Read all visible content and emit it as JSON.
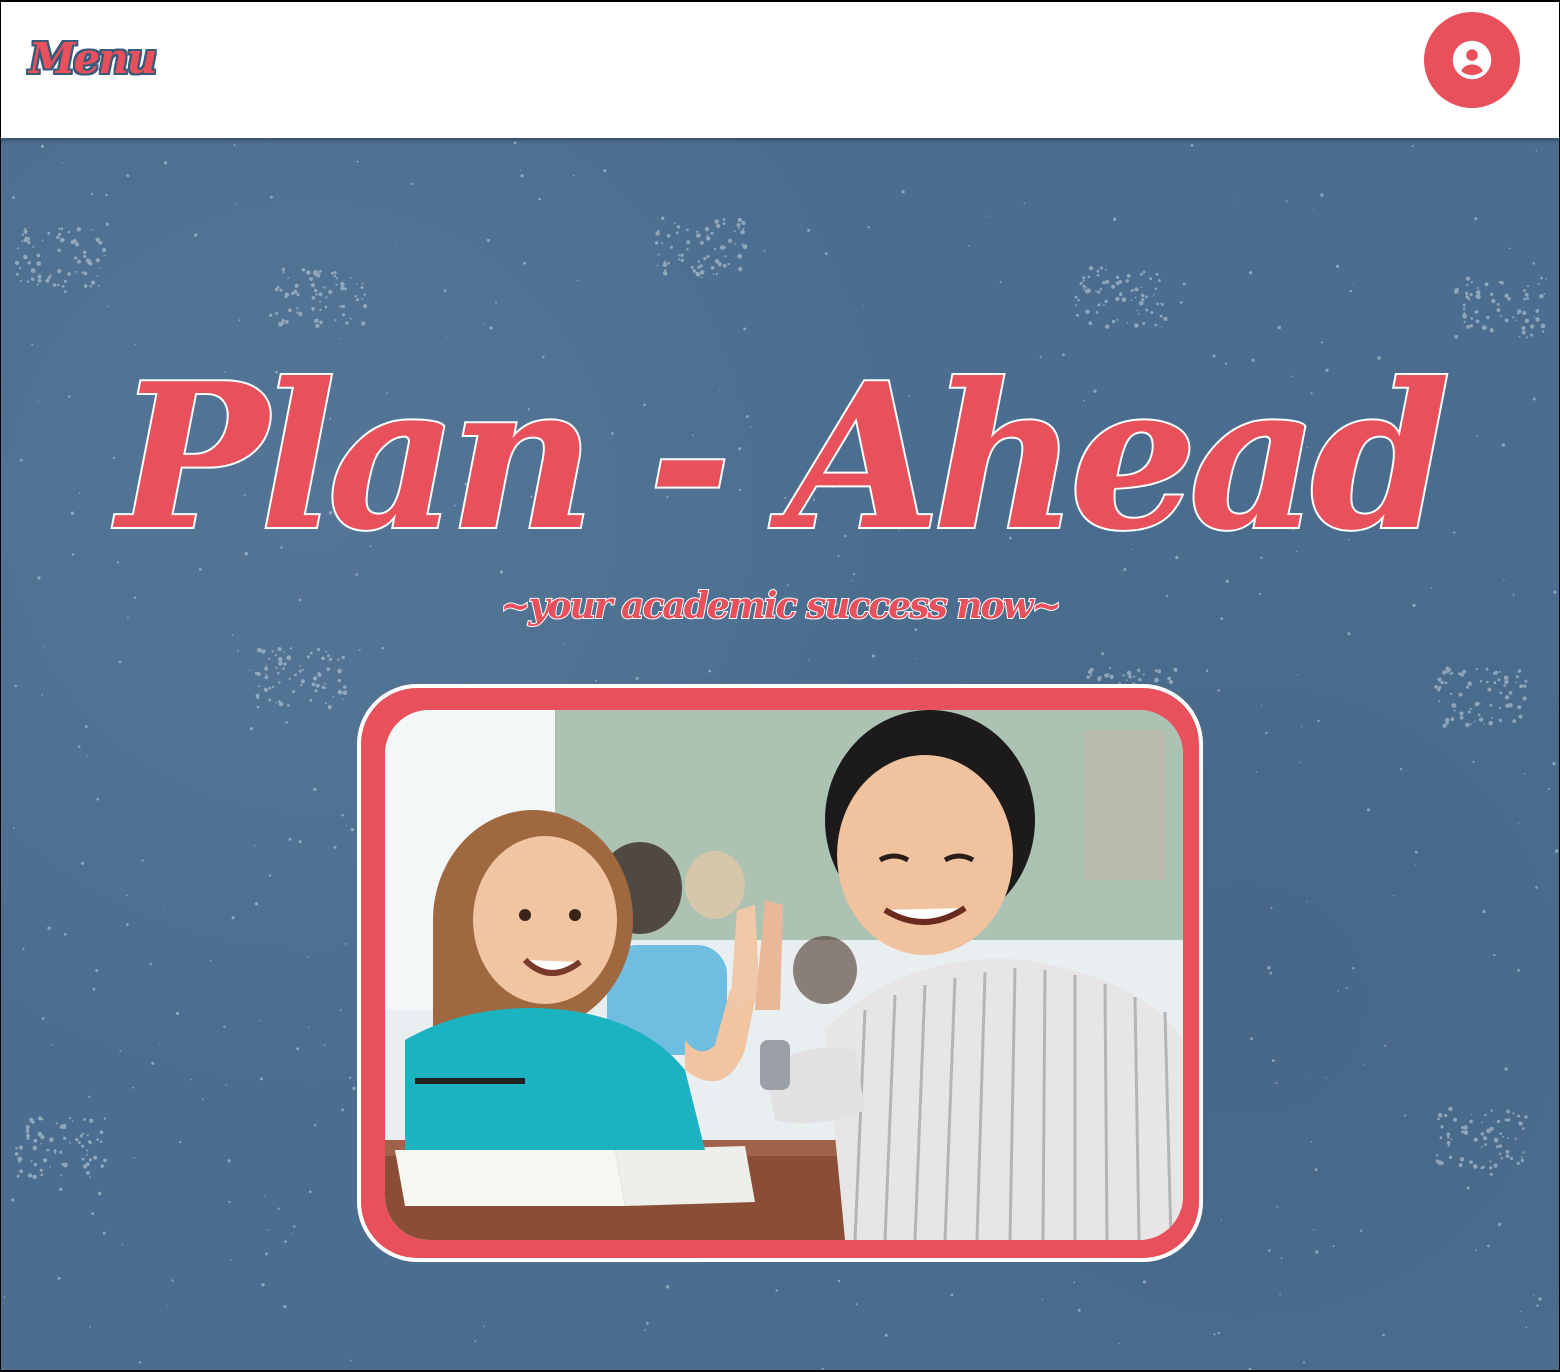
{
  "header": {
    "menu_label": "Menu",
    "account_icon": "account-circle-icon"
  },
  "hero": {
    "title": "Plan - Ahead",
    "tagline": "~your academic success now~",
    "photo_alt": "Teacher giving a high five to a smiling girl in a classroom"
  },
  "colors": {
    "accent": "#e8505b",
    "background": "#4b6e90",
    "header_bg": "#ffffff"
  }
}
